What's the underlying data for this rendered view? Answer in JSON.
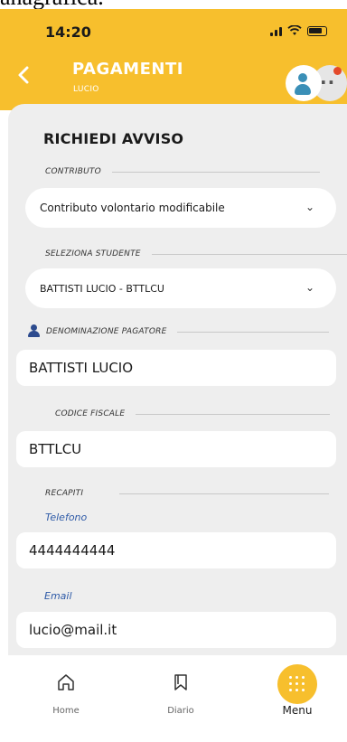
{
  "top_strip_text": "anagrafica.",
  "status_bar": {
    "time": "14:20"
  },
  "header": {
    "title": "PAGAMENTI",
    "subtitle": "LUCIO",
    "back_icon": "chevron-left-icon"
  },
  "colors": {
    "brand": "#f7bf2d",
    "card_bg": "#eeeeee",
    "accent_blue": "#2e5aa7"
  },
  "form": {
    "title": "RICHIEDI AVVISO",
    "contributo": {
      "label": "CONTRIBUTO",
      "value": "Contributo volontario modificabile"
    },
    "studente": {
      "label": "SELEZIONA STUDENTE",
      "value": "BATTISTI LUCIO - BTTLCU"
    },
    "denominazione": {
      "label": "DENOMINAZIONE PAGATORE",
      "value": "BATTISTI LUCIO"
    },
    "codice_fiscale": {
      "label": "CODICE FISCALE",
      "value": "BTTLCU"
    },
    "recapiti": {
      "label": "RECAPITI",
      "telefono_label": "Telefono",
      "telefono_value": "4444444444",
      "email_label": "Email",
      "email_value": "lucio@mail.it"
    }
  },
  "tabbar": {
    "items": [
      {
        "label": "Home",
        "icon": "home-icon"
      },
      {
        "label": "Diario",
        "icon": "bookmark-icon"
      },
      {
        "label": "Menu",
        "icon": "grid-dots-icon",
        "active": true
      }
    ]
  }
}
